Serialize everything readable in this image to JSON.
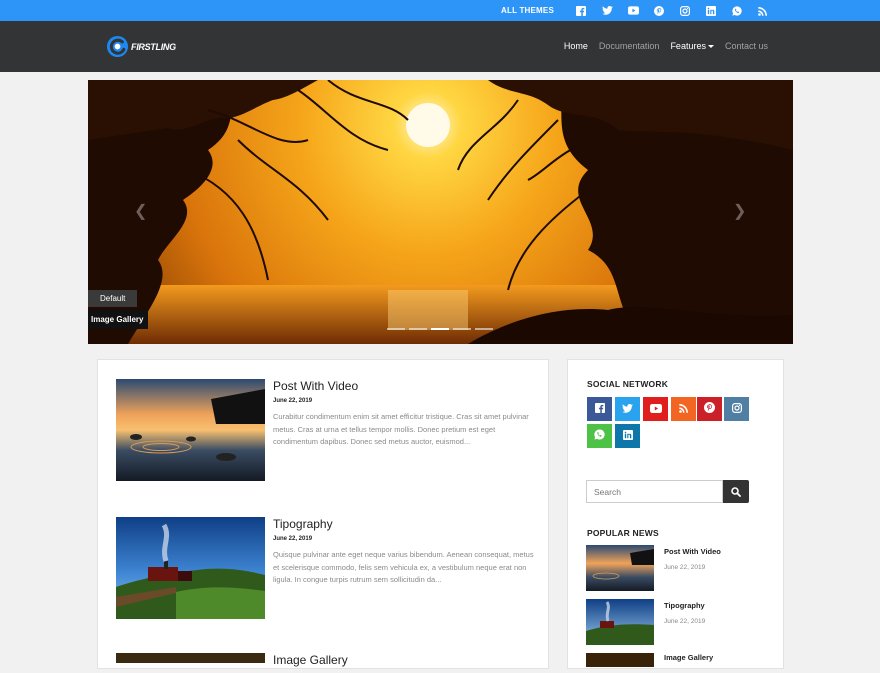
{
  "topbar": {
    "all_themes": "ALL THEMES",
    "icons": [
      "facebook-icon",
      "twitter-icon",
      "youtube-icon",
      "pinterest-icon",
      "instagram-icon",
      "linkedin-icon",
      "whatsapp-icon",
      "rss-icon"
    ]
  },
  "nav": {
    "logo_text": "FIRSTLING",
    "items": [
      {
        "label": "Home"
      },
      {
        "label": "Documentation"
      },
      {
        "label": "Features"
      },
      {
        "label": "Contact us"
      }
    ]
  },
  "slider": {
    "badge": "Default",
    "caption": "Image Gallery",
    "slide_count": 5,
    "active_slide": 3
  },
  "posts": [
    {
      "title": "Post With Video",
      "date": "June 22, 2019",
      "excerpt": "Curabitur condimentum enim sit amet efficitur tristique. Cras sit amet pulvinar metus. Cras at urna et tellus tempor mollis. Donec pretium est eget condimentum dapibus. Donec sed metus auctor, euismod..."
    },
    {
      "title": "Tipography",
      "date": "June 22, 2019",
      "excerpt": "Quisque pulvinar ante eget neque varius bibendum. Aenean consequat, metus et scelerisque commodo, felis sem vehicula ex, a vestibulum neque erat non ligula. In congue turpis rutrum sem sollicitudin da..."
    },
    {
      "title": "Image Gallery",
      "date": "",
      "excerpt": ""
    }
  ],
  "sidebar": {
    "social_title": "SOCIAL NETWORK",
    "social": [
      {
        "icon": "facebook-icon",
        "color": "#3b5998"
      },
      {
        "icon": "twitter-icon",
        "color": "#2aa3ef"
      },
      {
        "icon": "youtube-icon",
        "color": "#e01e1e"
      },
      {
        "icon": "rss-icon",
        "color": "#f26522"
      },
      {
        "icon": "pinterest-icon",
        "color": "#cb2027"
      },
      {
        "icon": "instagram-icon",
        "color": "#517fa4"
      },
      {
        "icon": "whatsapp-icon",
        "color": "#4dc247"
      },
      {
        "icon": "linkedin-icon",
        "color": "#0e76a8"
      }
    ],
    "search_placeholder": "Search",
    "popular_title": "POPULAR NEWS",
    "popular": [
      {
        "title": "Post With Video",
        "date": "June 22, 2019"
      },
      {
        "title": "Tipography",
        "date": "June 22, 2019"
      },
      {
        "title": "Image Gallery",
        "date": ""
      }
    ]
  },
  "colors": {
    "topbar": "#2d95f7",
    "navbar": "#333435",
    "background": "#f1f1f1"
  }
}
